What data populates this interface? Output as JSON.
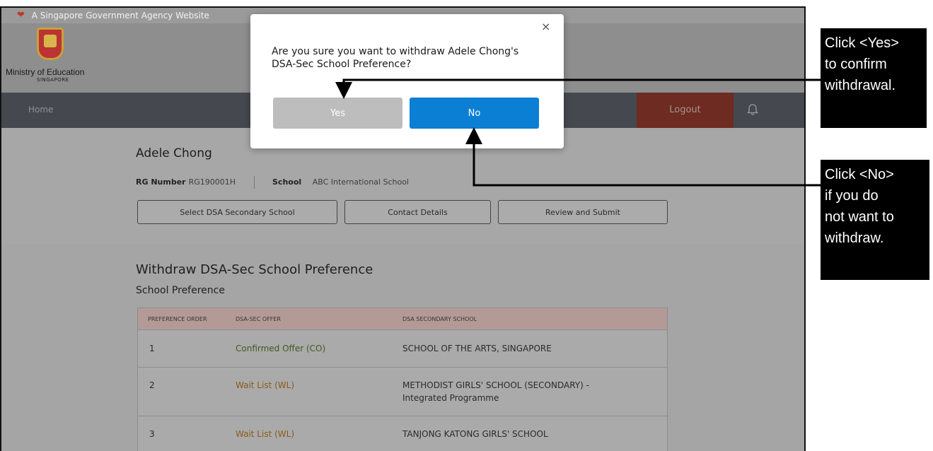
{
  "gov_bar": {
    "text": "A Singapore Government Agency Website"
  },
  "brand": {
    "name": "Ministry of Education",
    "sub": "SINGAPORE"
  },
  "nav": {
    "home": "Home",
    "logout": "Logout"
  },
  "student": {
    "name": "Adele Chong",
    "rg_label": "RG Number",
    "rg_value": "RG190001H",
    "school_label": "School",
    "school_value": "ABC International School"
  },
  "steps": [
    "Select DSA Secondary School",
    "Contact Details",
    "Review and Submit"
  ],
  "page": {
    "title": "Withdraw DSA-Sec School Preference",
    "section": "School Preference"
  },
  "table": {
    "headers": [
      "PREFERENCE ORDER",
      "DSA-SEC OFFER",
      "DSA SECONDARY SCHOOL"
    ],
    "rows": [
      {
        "order": "1",
        "offer": "Confirmed Offer (CO)",
        "school": "SCHOOL OF THE ARTS, SINGAPORE"
      },
      {
        "order": "2",
        "offer": "Wait List (WL)",
        "school": "METHODIST GIRLS' SCHOOL (SECONDARY) -",
        "school2": "Integrated Programme"
      },
      {
        "order": "3",
        "offer": "Wait List (WL)",
        "school": "TANJONG KATONG GIRLS' SCHOOL"
      }
    ]
  },
  "modal": {
    "message_line1": "Are you sure you want to withdraw Adele Chong's",
    "message_line2": "DSA-Sec School Preference?",
    "yes": "Yes",
    "no": "No",
    "close": "×"
  },
  "callouts": {
    "yes": [
      "Click <Yes>",
      "to confirm",
      "withdrawal."
    ],
    "no": [
      "Click <No>",
      "if you do",
      "not want to",
      "withdraw."
    ]
  },
  "colors": {
    "primary_button": "#0b7fd4",
    "confirmed": "#3d5c1f",
    "waitlist": "#8a5a1a",
    "logout": "#6d2b22"
  }
}
